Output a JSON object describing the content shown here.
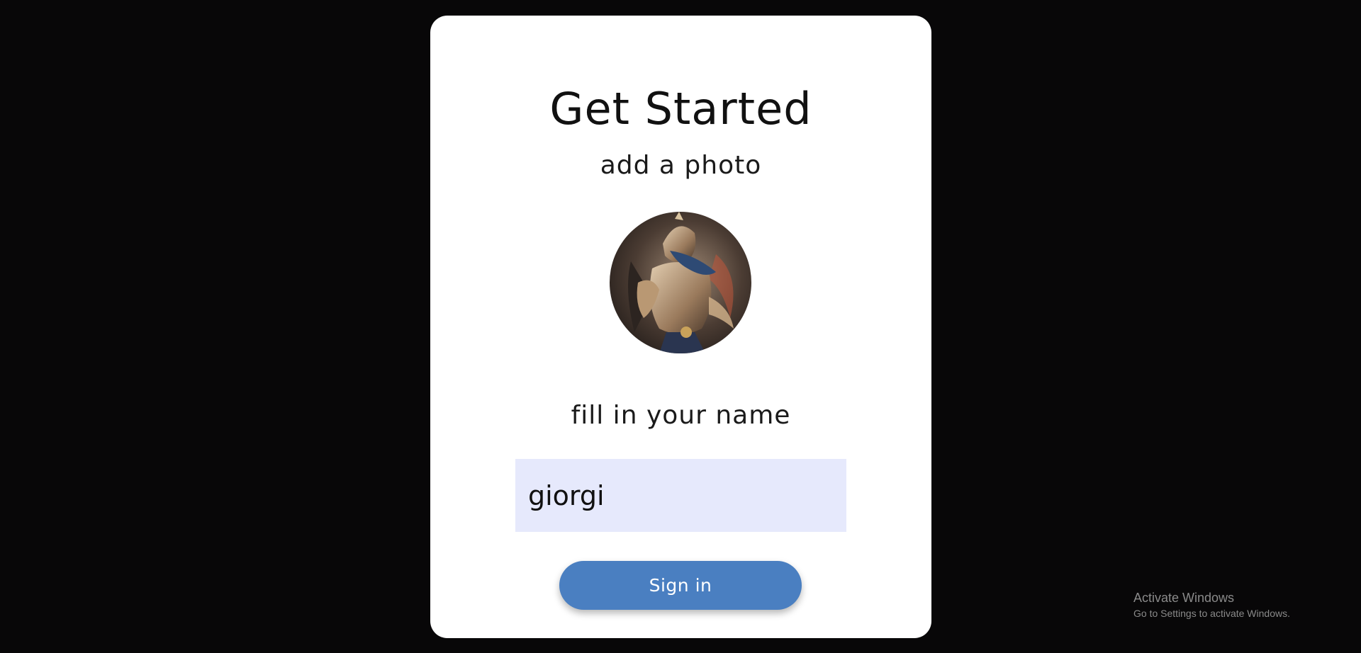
{
  "signup": {
    "title": "Get Started",
    "photo_prompt": "add a photo",
    "name_prompt": "fill in your name",
    "name_value": "giorgi",
    "submit_label": "Sign in"
  },
  "avatar": {
    "icon": "profile-photo-avatar"
  },
  "watermark": {
    "title": "Activate Windows",
    "subtitle": "Go to Settings to activate Windows."
  },
  "colors": {
    "page_background": "#080708",
    "card_background": "#ffffff",
    "input_background": "#e6e9fc",
    "button_background": "#4a7fc1",
    "button_text": "#ffffff"
  }
}
